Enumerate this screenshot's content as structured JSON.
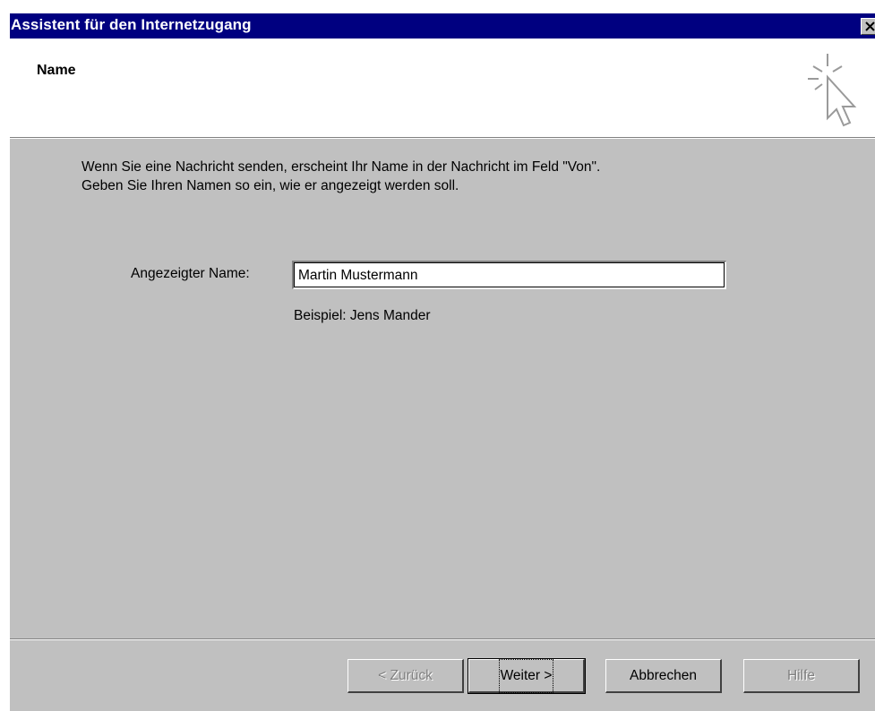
{
  "window": {
    "title": "Assistent für den Internetzugang"
  },
  "header": {
    "title": "Name",
    "icon": "wizard-cursor-icon"
  },
  "body": {
    "line1": "Wenn Sie eine Nachricht senden, erscheint Ihr Name in der Nachricht im Feld \"Von\".",
    "line2": "Geben Sie Ihren Namen so ein, wie er angezeigt werden soll.",
    "field_label": "Angezeigter Name:",
    "field_value": "Martin Mustermann",
    "example": "Beispiel: Jens Mander"
  },
  "buttons": {
    "back": "< Zurück",
    "next": "Weiter >",
    "cancel": "Abbrechen",
    "help": "Hilfe"
  },
  "colors": {
    "titlebar": "#000080",
    "face": "#c0c0c0"
  }
}
